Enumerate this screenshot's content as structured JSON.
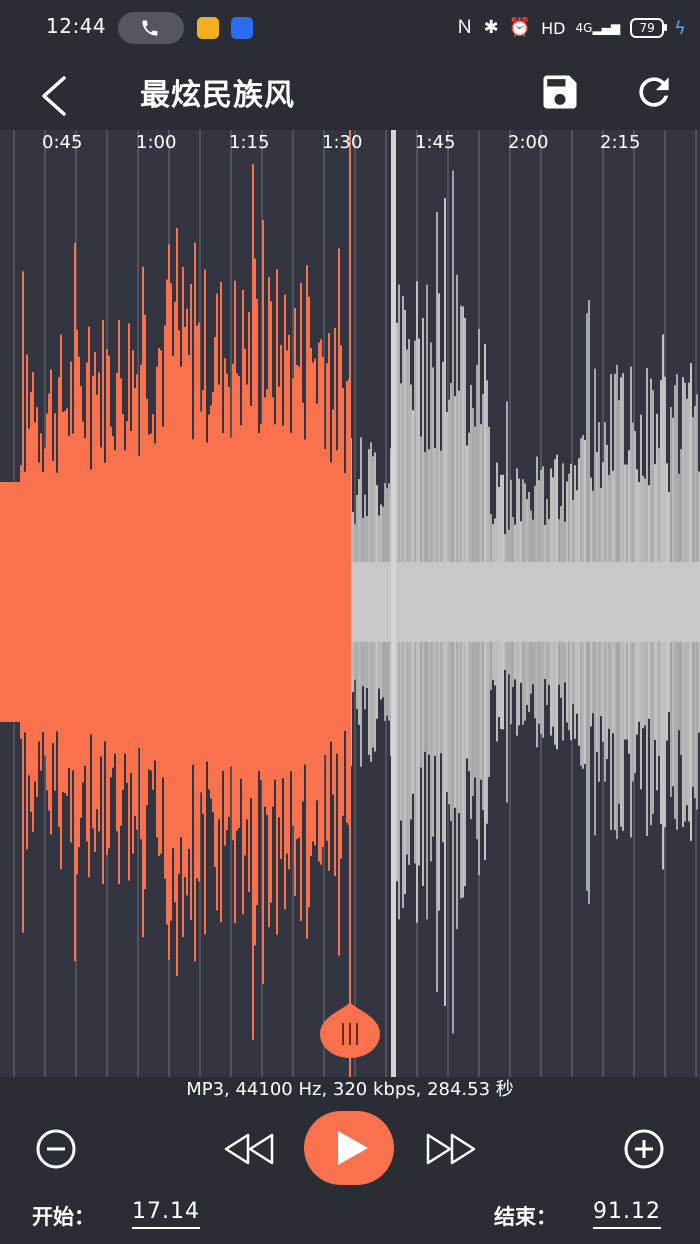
{
  "status_bar": {
    "time": "12:44",
    "right_text": "HD",
    "signal": "4G",
    "battery": "79"
  },
  "app_bar": {
    "back_icon": "chevron-left-icon",
    "title": "最炫民族风",
    "save_icon": "save-icon",
    "reload_icon": "refresh-icon"
  },
  "timeline": {
    "labels": [
      "0:45",
      "1:00",
      "1:15",
      "1:30",
      "1:45",
      "2:00",
      "2:15"
    ]
  },
  "waveform": {
    "selected_color": "#f9724d",
    "unselected_color": "#c8c8c8",
    "background_color": "#333541",
    "playhead_color": "#d4d4d4",
    "handle_color": "#f9724d"
  },
  "file_info": "MP3, 44100 Hz, 320 kbps, 284.53 秒",
  "controls": {
    "zoom_out_icon": "minus-circle-icon",
    "rewind_icon": "rewind-icon",
    "play_icon": "play-icon",
    "forward_icon": "fast-forward-icon",
    "zoom_in_icon": "plus-circle-icon"
  },
  "range": {
    "start_label": "开始：",
    "start_value": "17.14",
    "end_label": "结束：",
    "end_value": "91.12"
  }
}
